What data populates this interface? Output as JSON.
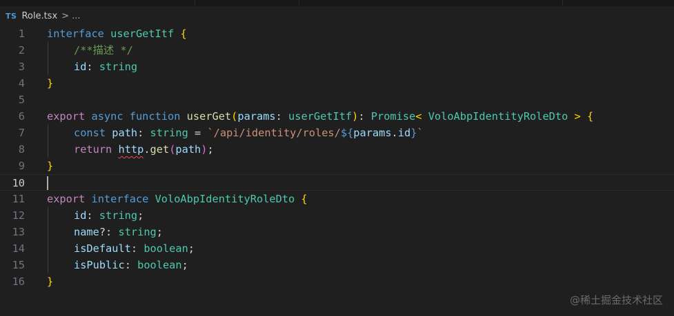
{
  "breadcrumb": {
    "file_icon_label": "TS",
    "file_name": "Role.tsx",
    "separator": ">",
    "ellipsis": "..."
  },
  "editor": {
    "current_line": 10,
    "lines": [
      {
        "n": "1",
        "tokens": [
          [
            "kw",
            "interface"
          ],
          [
            "punc",
            " "
          ],
          [
            "type",
            "userGetItf"
          ],
          [
            "punc",
            " "
          ],
          [
            "brace1",
            "{"
          ]
        ]
      },
      {
        "n": "2",
        "indent": 1,
        "tokens": [
          [
            "cmt",
            "/**描述 */"
          ]
        ]
      },
      {
        "n": "3",
        "indent": 1,
        "tokens": [
          [
            "var",
            "id"
          ],
          [
            "punc",
            ": "
          ],
          [
            "type",
            "string"
          ]
        ]
      },
      {
        "n": "4",
        "tokens": [
          [
            "brace1",
            "}"
          ]
        ]
      },
      {
        "n": "5",
        "tokens": []
      },
      {
        "n": "6",
        "tokens": [
          [
            "ctl",
            "export"
          ],
          [
            "punc",
            " "
          ],
          [
            "kw",
            "async"
          ],
          [
            "punc",
            " "
          ],
          [
            "kw",
            "function"
          ],
          [
            "punc",
            " "
          ],
          [
            "fn",
            "userGet"
          ],
          [
            "brace1",
            "("
          ],
          [
            "var",
            "params"
          ],
          [
            "punc",
            ": "
          ],
          [
            "type",
            "userGetItf"
          ],
          [
            "brace1",
            ")"
          ],
          [
            "punc",
            ": "
          ],
          [
            "type",
            "Promise"
          ],
          [
            "brace1",
            "<"
          ],
          [
            "punc",
            " "
          ],
          [
            "type",
            "VoloAbpIdentityRoleDto"
          ],
          [
            "punc",
            " "
          ],
          [
            "brace1",
            ">"
          ],
          [
            "punc",
            " "
          ],
          [
            "brace1",
            "{"
          ]
        ]
      },
      {
        "n": "7",
        "indent": 1,
        "tokens": [
          [
            "kw",
            "const"
          ],
          [
            "punc",
            " "
          ],
          [
            "var",
            "path"
          ],
          [
            "punc",
            ": "
          ],
          [
            "type",
            "string"
          ],
          [
            "punc",
            " = "
          ],
          [
            "str",
            "`/api/identity/roles/"
          ],
          [
            "kw",
            "${"
          ],
          [
            "var",
            "params"
          ],
          [
            "punc",
            "."
          ],
          [
            "var",
            "id"
          ],
          [
            "kw",
            "}"
          ],
          [
            "str",
            "`"
          ]
        ]
      },
      {
        "n": "8",
        "indent": 1,
        "tokens": [
          [
            "ctl",
            "return"
          ],
          [
            "punc",
            " "
          ],
          [
            "var squiggle",
            "http"
          ],
          [
            "punc",
            "."
          ],
          [
            "fn",
            "get"
          ],
          [
            "brace2",
            "("
          ],
          [
            "var",
            "path"
          ],
          [
            "brace2",
            ")"
          ],
          [
            "punc",
            ";"
          ]
        ]
      },
      {
        "n": "9",
        "tokens": [
          [
            "brace1",
            "}"
          ]
        ]
      },
      {
        "n": "10",
        "tokens": []
      },
      {
        "n": "11",
        "tokens": [
          [
            "ctl",
            "export"
          ],
          [
            "punc",
            " "
          ],
          [
            "kw",
            "interface"
          ],
          [
            "punc",
            " "
          ],
          [
            "type",
            "VoloAbpIdentityRoleDto"
          ],
          [
            "punc",
            " "
          ],
          [
            "brace1",
            "{"
          ]
        ]
      },
      {
        "n": "12",
        "indent": 1,
        "tokens": [
          [
            "var",
            "id"
          ],
          [
            "punc",
            ": "
          ],
          [
            "type",
            "string"
          ],
          [
            "punc",
            ";"
          ]
        ]
      },
      {
        "n": "13",
        "indent": 1,
        "tokens": [
          [
            "var",
            "name"
          ],
          [
            "punc",
            "?: "
          ],
          [
            "type",
            "string"
          ],
          [
            "punc",
            ";"
          ]
        ]
      },
      {
        "n": "14",
        "indent": 1,
        "tokens": [
          [
            "var",
            "isDefault"
          ],
          [
            "punc",
            ": "
          ],
          [
            "type",
            "boolean"
          ],
          [
            "punc",
            ";"
          ]
        ]
      },
      {
        "n": "15",
        "indent": 1,
        "tokens": [
          [
            "var",
            "isPublic"
          ],
          [
            "punc",
            ": "
          ],
          [
            "type",
            "boolean"
          ],
          [
            "punc",
            ";"
          ]
        ]
      },
      {
        "n": "16",
        "tokens": [
          [
            "brace1",
            "}"
          ]
        ]
      }
    ]
  },
  "watermark": "@稀土掘金技术社区"
}
